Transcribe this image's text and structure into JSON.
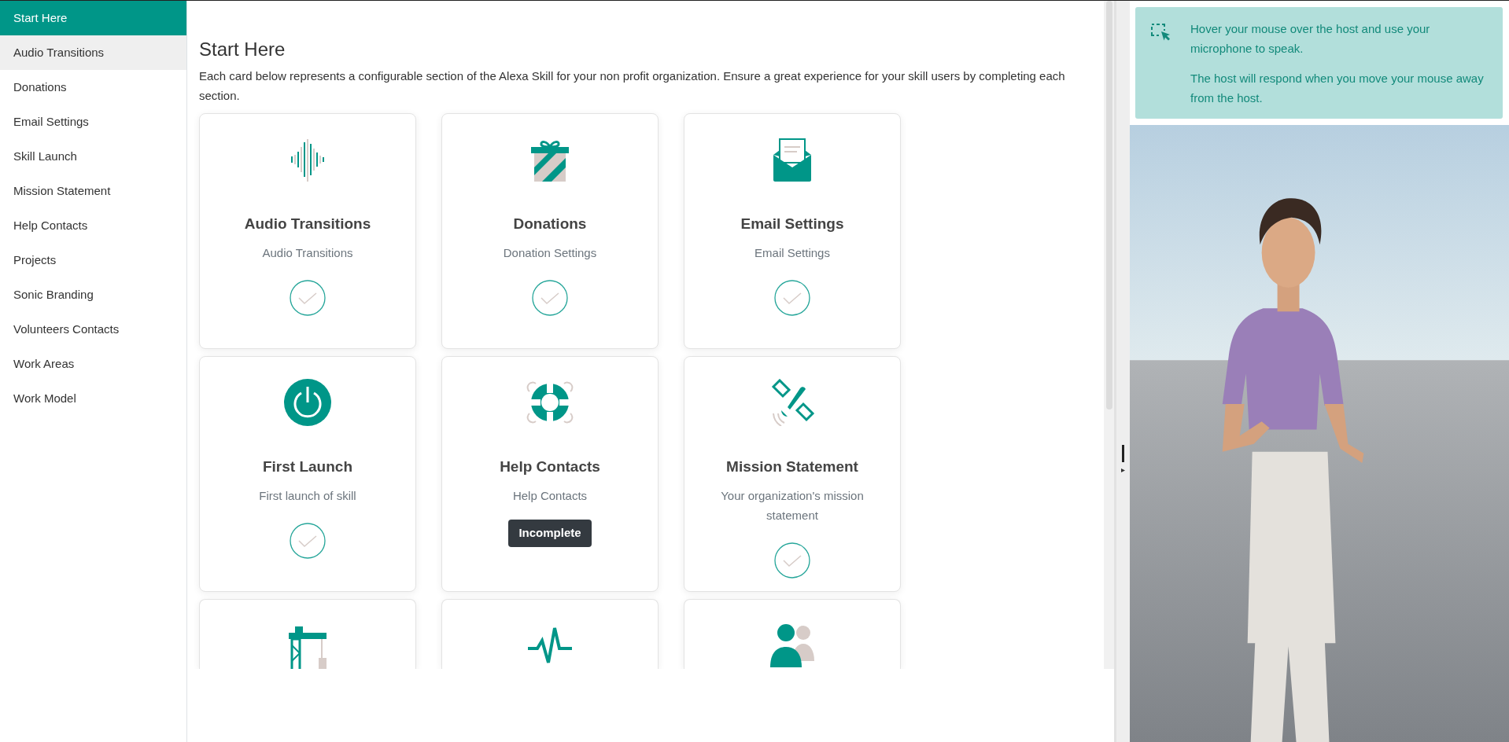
{
  "sidebar": {
    "items": [
      {
        "label": "Start Here",
        "selected": true,
        "hovered": false
      },
      {
        "label": "Audio Transitions",
        "selected": false,
        "hovered": true
      },
      {
        "label": "Donations",
        "selected": false,
        "hovered": false
      },
      {
        "label": "Email Settings",
        "selected": false,
        "hovered": false
      },
      {
        "label": "Skill Launch",
        "selected": false,
        "hovered": false
      },
      {
        "label": "Mission Statement",
        "selected": false,
        "hovered": false
      },
      {
        "label": "Help Contacts",
        "selected": false,
        "hovered": false
      },
      {
        "label": "Projects",
        "selected": false,
        "hovered": false
      },
      {
        "label": "Sonic Branding",
        "selected": false,
        "hovered": false
      },
      {
        "label": "Volunteers Contacts",
        "selected": false,
        "hovered": false
      },
      {
        "label": "Work Areas",
        "selected": false,
        "hovered": false
      },
      {
        "label": "Work Model",
        "selected": false,
        "hovered": false
      }
    ]
  },
  "main": {
    "title": "Start Here",
    "description": "Each card below represents a configurable section of the Alexa Skill for your non profit organization. Ensure a great experience for your skill users by completing each section.",
    "cards": [
      {
        "kind": "full",
        "title": "Audio Transitions",
        "subtitle": "Audio Transitions",
        "complete": true
      },
      {
        "kind": "full",
        "title": "Donations",
        "subtitle": "Donation Settings",
        "complete": true
      },
      {
        "kind": "full",
        "title": "Email Settings",
        "subtitle": "Email Settings",
        "complete": true
      },
      {
        "kind": "full",
        "title": "First Launch",
        "subtitle": "First launch of skill",
        "complete": true
      },
      {
        "kind": "full",
        "title": "Help Contacts",
        "subtitle": "Help Contacts",
        "complete": false,
        "status_label": "Incomplete"
      },
      {
        "kind": "full",
        "title": "Mission Statement",
        "subtitle": "Your organization's mission statement",
        "complete": true
      },
      {
        "kind": "partial"
      },
      {
        "kind": "partial"
      },
      {
        "kind": "partial"
      }
    ]
  },
  "host_panel": {
    "notice": [
      "Hover your mouse over the host and use your microphone to speak.",
      "The host will respond when you move your mouse away from the host."
    ]
  }
}
